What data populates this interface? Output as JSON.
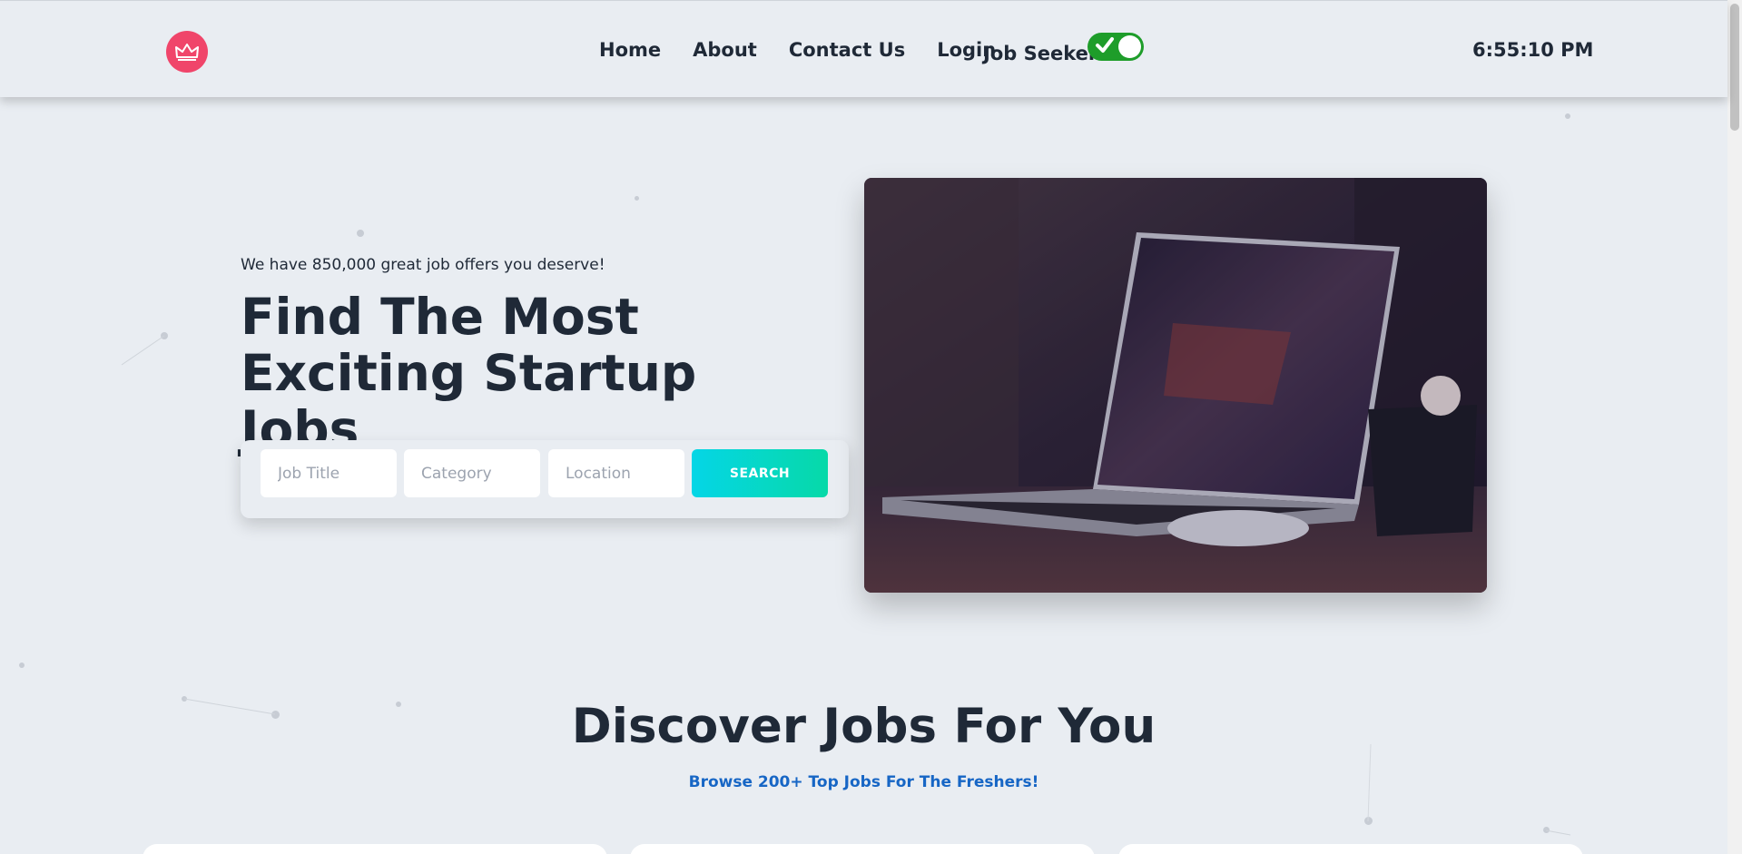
{
  "header": {
    "nav": [
      "Home",
      "About",
      "Contact Us",
      "Login"
    ],
    "mode_label": "Job Seeker",
    "toggle_on": true,
    "clock": "6:55:10 PM"
  },
  "hero": {
    "subtitle": "We have 850,000 great job offers you deserve!",
    "title": "Find The Most Exciting Startup Jobs",
    "search": {
      "job_title_placeholder": "Job Title",
      "category_placeholder": "Category",
      "location_placeholder": "Location",
      "button_label": "SEARCH"
    }
  },
  "discover": {
    "title": "Discover Jobs For You",
    "subtitle": "Browse 200+ Top Jobs For The Freshers!"
  },
  "colors": {
    "logo": "#f0456a",
    "toggle": "#1e9d2a",
    "search_button_start": "#05d6e6",
    "search_button_end": "#06d9a8",
    "accent_text": "#1766c5"
  },
  "icons": {
    "logo": "crown-icon",
    "toggle": "check-icon"
  }
}
